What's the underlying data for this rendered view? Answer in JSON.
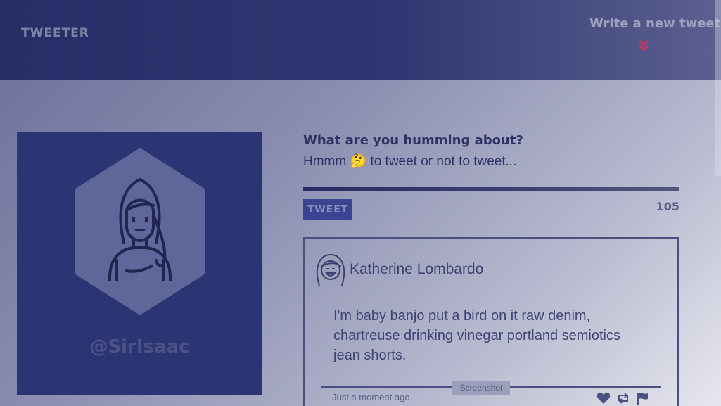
{
  "header": {
    "logo": "TWEETER",
    "compose_link": "Write a new tweet",
    "chevron_icon": "double-chevron-down-icon",
    "accent_color": "#c0395e"
  },
  "profile": {
    "handle": "@SirIsaac",
    "avatar_icon": "avatar-girl-icon"
  },
  "compose": {
    "prompt": "What are you humming about?",
    "input_value": "Hmmm 🤔 to tweet or not to tweet...",
    "button_label": "TWEET",
    "char_count": "105"
  },
  "tweet": {
    "author_name": "Katherine Lombardo",
    "body": "I'm baby banjo put a bird on it raw denim, chartreuse drinking vinegar portland semiotics jean shorts.",
    "timestamp": "Just a moment ago.",
    "overlay_label": "Screenshot",
    "actions": [
      "heart-icon",
      "retweet-icon",
      "flag-icon"
    ]
  }
}
